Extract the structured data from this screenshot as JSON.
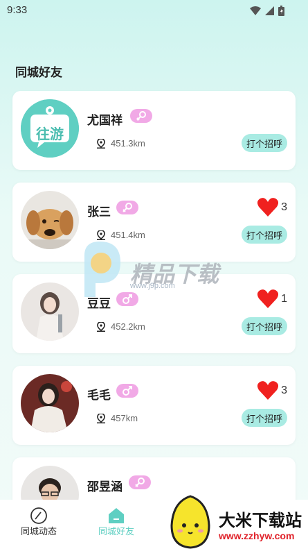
{
  "status_bar": {
    "time": "9:33"
  },
  "section_title": "同城好友",
  "users": [
    {
      "name": "尤国祥",
      "gender": "female",
      "distance": "451.3km",
      "likes": null,
      "greet": "打个招呼",
      "avatar": "app-logo"
    },
    {
      "name": "张三",
      "gender": "female",
      "distance": "451.4km",
      "likes": "3",
      "greet": "打个招呼",
      "avatar": "dog-photo"
    },
    {
      "name": "豆豆",
      "gender": "male",
      "distance": "452.2km",
      "likes": "1",
      "greet": "打个招呼",
      "avatar": "girl-photo"
    },
    {
      "name": "毛毛",
      "gender": "male",
      "distance": "457km",
      "likes": "3",
      "greet": "打个招呼",
      "avatar": "girl-christmas-photo"
    },
    {
      "name": "邵昱涵",
      "gender": "female",
      "distance": "",
      "likes": null,
      "greet": "",
      "avatar": "man-photo"
    }
  ],
  "avatar_logo_text": "往游",
  "tabs": [
    {
      "label": "同城动态",
      "icon": "compass-icon",
      "active": false
    },
    {
      "label": "同城好友",
      "icon": "home-icon",
      "active": true
    }
  ],
  "watermark_center": {
    "text": "精品下载",
    "url": "www.j9p.com"
  },
  "watermark_corner": {
    "text": "大米下载站",
    "url": "www.zzhyw.com"
  },
  "colors": {
    "accent": "#5fcfc2",
    "gender_badge": "#f1a9e6",
    "greet_button": "#a9ebe3",
    "heart": "#f0211f"
  }
}
